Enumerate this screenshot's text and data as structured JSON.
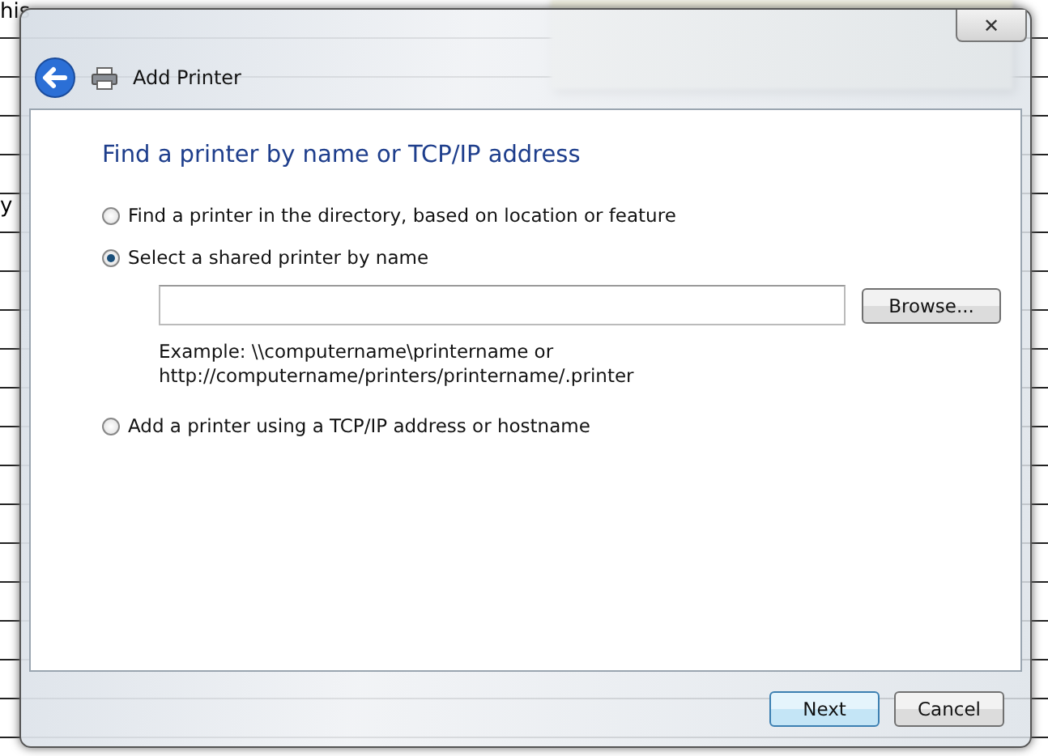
{
  "background": {
    "texts": [
      "his",
      "y"
    ]
  },
  "window": {
    "title": "Add Printer",
    "close": "✕"
  },
  "heading": "Find a printer by name or TCP/IP address",
  "options": [
    {
      "label": "Find a printer in the directory, based on location or feature",
      "selected": false
    },
    {
      "label": "Select a shared printer by name",
      "selected": true
    },
    {
      "label": "Add a printer using a TCP/IP address or hostname",
      "selected": false
    }
  ],
  "shared": {
    "browse": "Browse...",
    "example": [
      "Example: \\\\computername\\printername or",
      "http://computername/printers/printername/.printer"
    ]
  },
  "buttons": [
    {
      "label": "Next",
      "default": true
    },
    {
      "label": "Cancel",
      "default": false
    }
  ]
}
